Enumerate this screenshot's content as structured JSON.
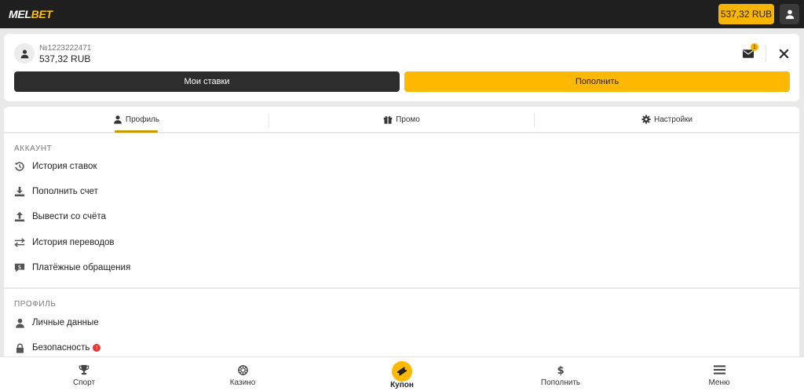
{
  "header": {
    "logo_main": "MEL",
    "logo_accent": "BET",
    "balance": "537,32 RUB"
  },
  "account": {
    "id": "№1223222471",
    "balance": "537,32 RUB",
    "mail_badge": "1",
    "my_bets_label": "Мои ставки",
    "deposit_label": "Пополнить"
  },
  "tabs": [
    {
      "label": "Профиль",
      "icon": "user-icon",
      "active": true
    },
    {
      "label": "Промо",
      "icon": "gift-icon",
      "active": false
    },
    {
      "label": "Настройки",
      "icon": "gear-icon",
      "active": false
    }
  ],
  "sections": {
    "account": {
      "title": "АККАУНТ",
      "items": [
        {
          "label": "История ставок",
          "icon": "history-icon"
        },
        {
          "label": "Пополнить счет",
          "icon": "download-icon"
        },
        {
          "label": "Вывести со счёта",
          "icon": "upload-icon"
        },
        {
          "label": "История переводов",
          "icon": "transfer-icon"
        },
        {
          "label": "Платёжные обращения",
          "icon": "payment-chat-icon"
        }
      ]
    },
    "profile": {
      "title": "ПРОФИЛЬ",
      "items": [
        {
          "label": "Личные данные",
          "icon": "user-icon"
        },
        {
          "label": "Безопасность",
          "icon": "lock-icon",
          "badge": "!"
        }
      ]
    }
  },
  "bottom_nav": [
    {
      "label": "Спорт",
      "icon": "trophy-icon"
    },
    {
      "label": "Казино",
      "icon": "casino-chip-icon"
    },
    {
      "label": "Купон",
      "icon": "ticket-icon",
      "active": true
    },
    {
      "label": "Пополнить",
      "icon": "dollar-icon"
    },
    {
      "label": "Меню",
      "icon": "menu-icon"
    }
  ],
  "colors": {
    "brand_yellow": "#ffb800",
    "dark": "#1f1f1f",
    "alert_red": "#e53935"
  }
}
